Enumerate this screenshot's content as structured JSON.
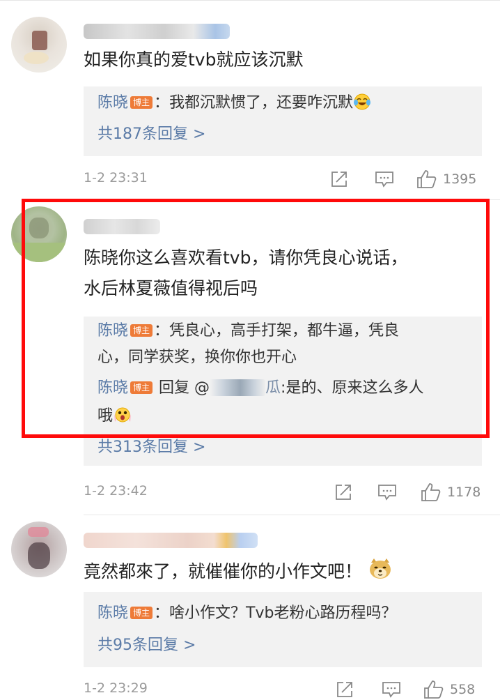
{
  "comments": [
    {
      "text": "如果你真的爱tvb就应该沉默",
      "replies": [
        {
          "author": "陈晓",
          "badge": "博主",
          "text": "：我都沉默惯了，还要咋沉默",
          "emoji": "laughing-crying-emoji"
        }
      ],
      "more_replies": "共187条回复 >",
      "time": "1-2 23:31",
      "likes": "1395"
    },
    {
      "text_lines": [
        "陈晓你这么喜欢看tvb，请你凭良心说话，",
        "水后林夏薇值得视后吗"
      ],
      "replies": [
        {
          "author": "陈晓",
          "badge": "博主",
          "text_lines": [
            "：凭良心，高手打架，都牛逼，凭良",
            "心，同学获奖，换你你也开心"
          ]
        },
        {
          "author": "陈晓",
          "badge": "博主",
          "prefix": " 回复 @",
          "mention_tail": "瓜",
          "text_after": ":是的、原来这么多人",
          "text_line2": "哦",
          "emoji": "shocked-face-emoji"
        }
      ],
      "more_replies": "共313条回复 >",
      "time": "1-2 23:42",
      "likes": "1178"
    },
    {
      "text": "竟然都來了，就催催你的小作文吧！",
      "emoji": "doge-emoji",
      "replies": [
        {
          "author": "陈晓",
          "badge": "博主",
          "text": "：啥小作文？Tvb老粉心路历程吗？"
        }
      ],
      "more_replies": "共95条回复 >",
      "time": "1-2 23:29",
      "likes": "558"
    }
  ],
  "colors": {
    "link": "#5b7ba7",
    "badge": "#ee7b38",
    "highlight": "#ff0a0a",
    "reply_bg": "#f2f2f2"
  },
  "icons": [
    "share-icon",
    "comment-icon",
    "like-icon"
  ]
}
